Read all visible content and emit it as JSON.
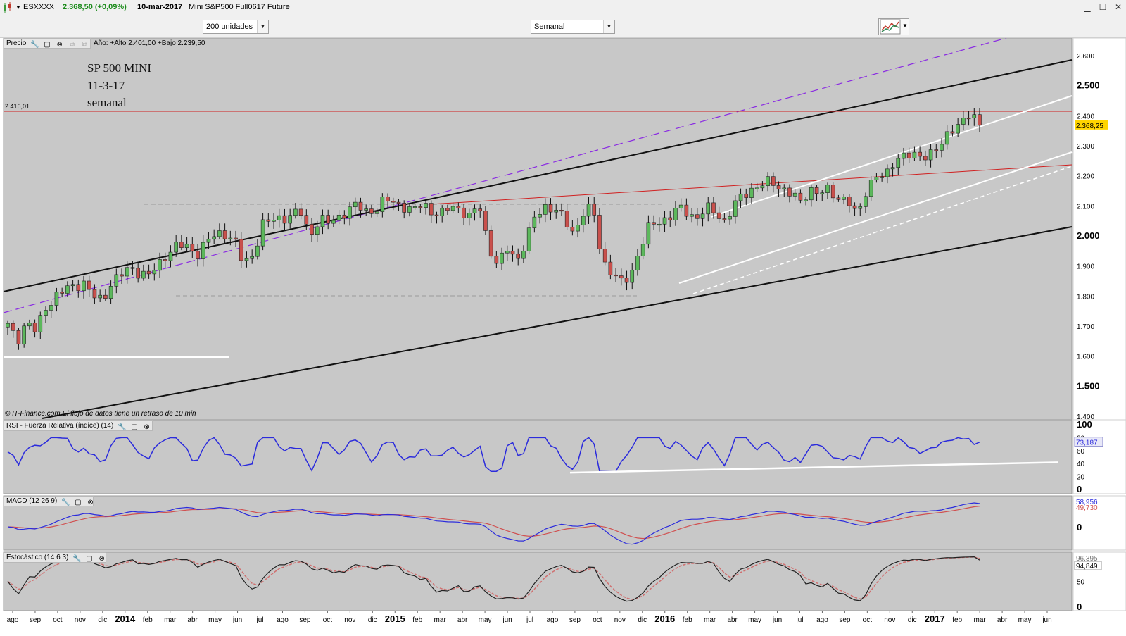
{
  "titlebar": {
    "symbol": "ESXXXX",
    "price_change": "2.368,50 (+0,09%)",
    "date": "10-mar-2017",
    "instrument": "Mini S&P500 Full0617 Future"
  },
  "toolbar": {
    "units_select": "200 unidades",
    "period_select": "Semanal"
  },
  "price_panel": {
    "label": "Precio",
    "info": "Año: +Alto 2.401,00 +Bajo 2.239,50",
    "annotation_lines": [
      "SP 500  MINI",
      "11-3-17",
      "semanal"
    ],
    "level_label": "2.416,01",
    "last_price_label": "2.368,25",
    "copyright": "© IT-Finance.com",
    "disclaimer": "El flujo de datos tiene un retraso de 10 min",
    "y_ticks": [
      "2.600",
      "2.500",
      "2.400",
      "2.300",
      "2.200",
      "2.100",
      "2.000",
      "1.900",
      "1.800",
      "1.700",
      "1.600",
      "1.500",
      "1.400"
    ]
  },
  "rsi_panel": {
    "label": "RSI - Fuerza Relativa (índice) (14)",
    "value_label": "73,187",
    "y_ticks": [
      "100",
      "80",
      "60",
      "40",
      "20",
      "0"
    ]
  },
  "macd_panel": {
    "label": "MACD (12 26 9)",
    "value_label_1": "58,956",
    "value_label_2": "49,730",
    "y_ticks": [
      "0"
    ]
  },
  "stoch_panel": {
    "label": "Estocástico (14 6 3)",
    "value_label_1": "96,395",
    "value_label_2": "94,849",
    "y_ticks": [
      "50",
      "0"
    ]
  },
  "x_axis": {
    "labels": [
      "ago",
      "sep",
      "oct",
      "nov",
      "dic",
      "2014",
      "feb",
      "mar",
      "abr",
      "may",
      "jun",
      "jul",
      "ago",
      "sep",
      "oct",
      "nov",
      "dic",
      "2015",
      "feb",
      "mar",
      "abr",
      "may",
      "jun",
      "jul",
      "ago",
      "sep",
      "oct",
      "nov",
      "dic",
      "2016",
      "feb",
      "mar",
      "abr",
      "may",
      "jun",
      "jul",
      "ago",
      "sep",
      "oct",
      "nov",
      "dic",
      "2017",
      "feb",
      "mar",
      "abr",
      "may",
      "jun"
    ],
    "bold_labels": [
      "2014",
      "2015",
      "2016",
      "2017"
    ]
  },
  "chart_data": {
    "type": "candlestick",
    "timeframe": "weekly",
    "period": "ago 2013 – mar 2017",
    "y_unit": "index points",
    "ylim": [
      1400,
      2650
    ],
    "close_anchors": [
      1700,
      1650,
      1720,
      1680,
      1760,
      1800,
      1820,
      1830,
      1850,
      1800,
      1780,
      1850,
      1870,
      1890,
      1880,
      1870,
      1900,
      1950,
      1970,
      1960,
      1940,
      1980,
      2000,
      2010,
      1990,
      1900,
      1940,
      2040,
      2050,
      2060,
      2070,
      2080,
      2000,
      2060,
      2040,
      2060,
      2090,
      2100,
      2080,
      2090,
      2120,
      2110,
      2100,
      2080,
      2110,
      2080,
      2070,
      2100,
      2090,
      2060,
      2100,
      1960,
      1900,
      1960,
      1920,
      1990,
      2070,
      2100,
      2090,
      2050,
      2010,
      2080,
      2090,
      1920,
      1880,
      1840,
      1870,
      1960,
      2030,
      2050,
      2060,
      2090,
      2080,
      2060,
      2090,
      2080,
      2050,
      2100,
      2140,
      2160,
      2170,
      2180,
      2160,
      2140,
      2110,
      2160,
      2140,
      2150,
      2130,
      2120,
      2060,
      2160,
      2200,
      2190,
      2260,
      2270,
      2260,
      2270,
      2280,
      2300,
      2360,
      2380,
      2400,
      2368.5
    ],
    "current_price": 2368.25,
    "year_high": 2401,
    "year_low": 2239.5,
    "horizontal_level": 2416.01,
    "rsi": {
      "period": 14,
      "last": 73.187,
      "ylim": [
        0,
        100
      ]
    },
    "macd": {
      "params": [
        12,
        26,
        9
      ],
      "macd_last": 58.956,
      "signal_last": 49.73
    },
    "stochastic": {
      "params": [
        14,
        6,
        3
      ],
      "k_last": 96.395,
      "d_last": 94.849,
      "ylim": [
        0,
        100
      ]
    },
    "colors": {
      "up": "#5cb85c",
      "down": "#c9504c",
      "rsi": "#2b2bdc",
      "macd": "#2b2bdc",
      "signal": "#d05050",
      "trend_purple": "#8a2be2",
      "level_line": "#d02020",
      "background": "#c8c8c8"
    }
  }
}
